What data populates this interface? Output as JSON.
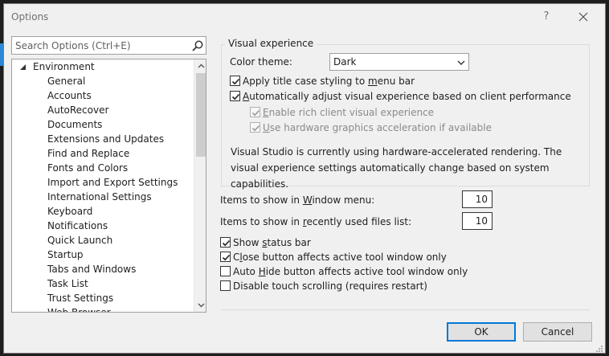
{
  "window": {
    "title": "Options",
    "help_label": "?"
  },
  "search": {
    "placeholder": "Search Options (Ctrl+E)"
  },
  "tree": {
    "root": "Environment",
    "items": [
      "General",
      "Accounts",
      "AutoRecover",
      "Documents",
      "Extensions and Updates",
      "Find and Replace",
      "Fonts and Colors",
      "Import and Export Settings",
      "International Settings",
      "Keyboard",
      "Notifications",
      "Quick Launch",
      "Startup",
      "Tabs and Windows",
      "Task List",
      "Trust Settings",
      "Web Browser"
    ]
  },
  "visual": {
    "group_title": "Visual experience",
    "color_theme_label_pre": "Color theme:",
    "color_theme_value": "Dark",
    "title_case_pre": "Apply title case styling to ",
    "title_case_u": "m",
    "title_case_post": "enu bar",
    "auto_adjust_u": "A",
    "auto_adjust_post": "utomatically adjust visual experience based on client performance",
    "rich_client_u": "E",
    "rich_client_post": "nable rich client visual experience",
    "hw_accel_u": "U",
    "hw_accel_post": "se hardware graphics acceleration if available",
    "info_text": "Visual Studio is currently using hardware-accelerated rendering. The visual experience settings automatically change based on system capabilities."
  },
  "items": {
    "window_menu_pre": "Items to show in ",
    "window_menu_u": "W",
    "window_menu_post": "indow menu:",
    "window_menu_value": "10",
    "recent_files_pre": "Items to show in ",
    "recent_files_u": "r",
    "recent_files_post": "ecently used files list:",
    "recent_files_value": "10"
  },
  "options": {
    "status_bar_pre": "Show ",
    "status_bar_u": "s",
    "status_bar_post": "tatus bar",
    "close_btn_pre": "C",
    "close_btn_u": "l",
    "close_btn_post": "ose button affects active tool window only",
    "auto_hide_pre": "Auto ",
    "auto_hide_u": "H",
    "auto_hide_post": "ide button affects active tool window only",
    "touch_label": "Disable touch scrolling (requires restart)"
  },
  "buttons": {
    "ok": "OK",
    "cancel": "Cancel"
  },
  "colors": {
    "accent": "#0078d7",
    "dialog_bg": "#f0f0f0"
  }
}
